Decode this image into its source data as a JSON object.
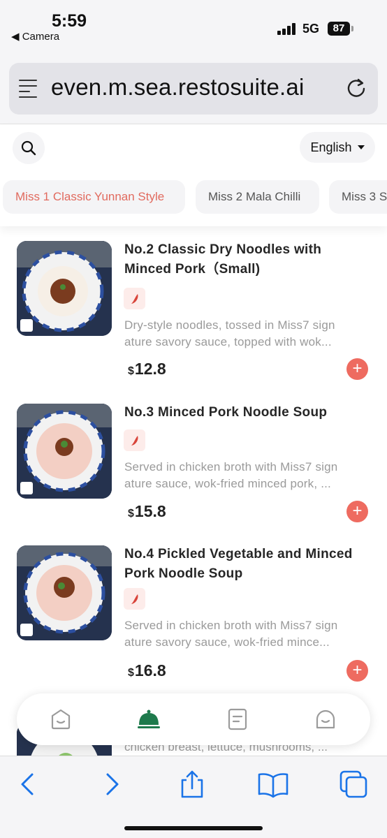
{
  "status_bar": {
    "time": "5:59",
    "back_label": "◀ Camera",
    "network": "5G",
    "battery": "87"
  },
  "browser": {
    "url": "even.m.sea.restosuite.ai"
  },
  "header": {
    "language": "English",
    "tabs": [
      {
        "label": "Miss 1 Classic Yunnan Style",
        "active": true
      },
      {
        "label": "Miss 2 Mala Chilli",
        "active": false
      },
      {
        "label": "Miss 3 S",
        "active": false
      }
    ]
  },
  "menu": {
    "items": [
      {
        "name_line1": "No.2 Classic Dry Noodles with",
        "name_line2": "Minced Pork（Small)",
        "desc_line1": "Dry-style noodles, tossed in Miss7 sign",
        "desc_line2": "ature savory sauce, topped with wok...",
        "currency": "$",
        "price": "12.8"
      },
      {
        "name_line1": "No.3 Minced Pork Noodle Soup",
        "name_line2": "",
        "desc_line1": "Served in chicken broth with Miss7 sign",
        "desc_line2": "ature sauce, wok-fried minced pork, ...",
        "currency": "$",
        "price": "15.8"
      },
      {
        "name_line1": "No.4 Pickled Vegetable and Minced",
        "name_line2": "Pork Noodle Soup",
        "desc_line1": "Served in chicken broth with Miss7 sign",
        "desc_line2": "ature savory sauce, wok-fried mince...",
        "currency": "$",
        "price": "16.8"
      }
    ],
    "peek_text": "chicken breast, lettuce, mushrooms, ..."
  },
  "icons": {
    "search": "search-icon",
    "chili": "chili-pepper-icon",
    "add": "plus-icon",
    "nav": [
      "home-face-icon",
      "cloche-icon",
      "order-list-icon",
      "profile-icon"
    ],
    "safari": [
      "back-arrow-icon",
      "forward-arrow-icon",
      "share-icon",
      "bookmarks-icon",
      "tabs-icon"
    ]
  },
  "colors": {
    "accent": "#e16a5e",
    "add_button": "#ee6b60",
    "active_nav": "#1e7a4c",
    "safari_blue": "#1a73e8"
  }
}
